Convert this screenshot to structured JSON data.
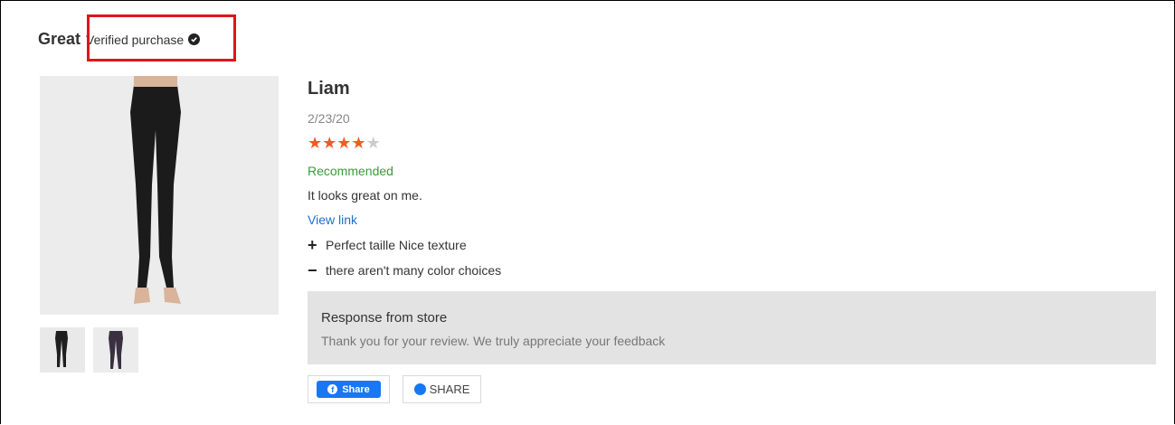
{
  "review": {
    "title": "Great",
    "verified_label": "Verified purchase",
    "reviewer": "Liam",
    "date": "2/23/20",
    "rating": 4,
    "rating_max": 5,
    "recommend_label": "Recommended",
    "text": "It looks great on me.",
    "link_label": "View link",
    "pro": "Perfect taille Nice texture",
    "con": "there aren't many color choices"
  },
  "response": {
    "title": "Response from store",
    "text": "Thank you for your review. We truly appreciate your feedback"
  },
  "share": {
    "facebook_label": "Share",
    "messenger_label": "SHARE"
  },
  "colors": {
    "star": "#f25b21",
    "recommend": "#3c9a3c",
    "link": "#1e6fd0",
    "facebook": "#1877f2",
    "highlight": "#e1131b"
  }
}
